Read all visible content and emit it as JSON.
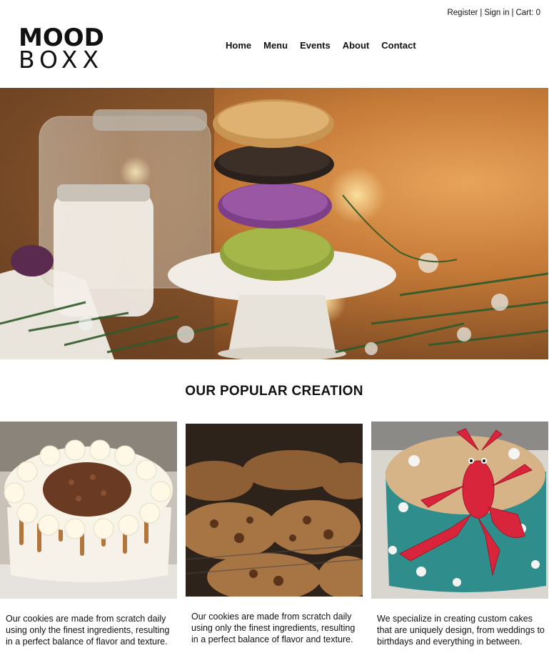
{
  "topbar": {
    "register": "Register",
    "sign_in": "Sign in",
    "cart": "Cart: 0",
    "separator": "|"
  },
  "logo": {
    "line1": "MOOD",
    "line2": "BOXX"
  },
  "nav": {
    "items": [
      {
        "label": "Home"
      },
      {
        "label": "Menu"
      },
      {
        "label": "Events"
      },
      {
        "label": "About"
      },
      {
        "label": "Contact"
      }
    ]
  },
  "hero": {
    "alt_icon": "stacked-cookies-photo"
  },
  "section": {
    "title": "OUR POPULAR CREATION"
  },
  "cards": [
    {
      "icon": "carrot-cake-photo",
      "text": "Our cookies are made from scratch daily using only the finest ingredients, resulting in a perfect balance of flavor and texture."
    },
    {
      "icon": "cookies-photo",
      "text": "Our cookies are made from scratch daily using only the finest ingredients, resulting in a perfect balance of flavor and texture."
    },
    {
      "icon": "lobster-cake-photo",
      "text": "We specialize in creating custom cakes that are uniquely design, from weddings to birthdays and everything in between."
    }
  ],
  "colors": {
    "text": "#111111",
    "background": "#ffffff",
    "hero_warm": "#c57a37"
  }
}
